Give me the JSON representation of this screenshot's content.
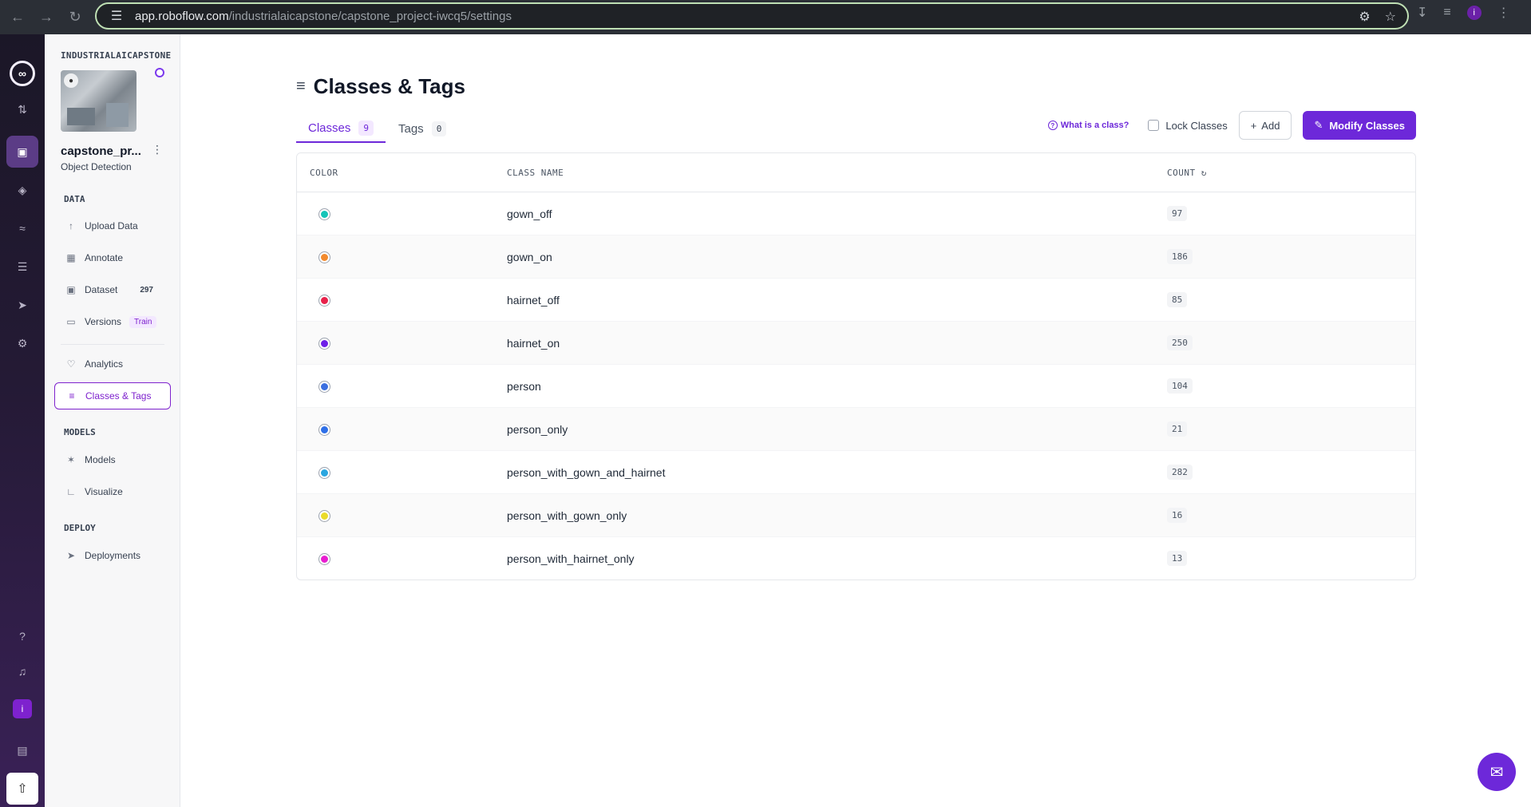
{
  "browser": {
    "url_host": "app.roboflow.com",
    "url_path": "/industrialaicapstone/capstone_project-iwcq5/settings"
  },
  "sidebar": {
    "workspace": "INDUSTRIALAICAPSTONE",
    "project_name": "capstone_pr...",
    "project_type": "Object Detection",
    "sections": {
      "data": "DATA",
      "models": "MODELS",
      "deploy": "DEPLOY"
    },
    "items": {
      "upload": "Upload Data",
      "annotate": "Annotate",
      "dataset": "Dataset",
      "dataset_count": "297",
      "versions": "Versions",
      "versions_badge": "Train",
      "analytics": "Analytics",
      "classes_tags": "Classes & Tags",
      "models": "Models",
      "visualize": "Visualize",
      "deployments": "Deployments"
    }
  },
  "rail": {
    "user_initial": "i"
  },
  "main": {
    "title": "Classes & Tags",
    "tabs": {
      "classes_label": "Classes",
      "classes_count": "9",
      "tags_label": "Tags",
      "tags_count": "0"
    },
    "actions": {
      "help": "What is a class?",
      "lock": "Lock Classes",
      "add": "Add",
      "modify": "Modify Classes"
    },
    "table": {
      "headers": [
        "COLOR",
        "CLASS NAME",
        "COUNT"
      ],
      "rows": [
        {
          "color": "#14c4b8",
          "name": "gown_off",
          "count": "97"
        },
        {
          "color": "#f28a2e",
          "name": "gown_on",
          "count": "186"
        },
        {
          "color": "#e8214a",
          "name": "hairnet_off",
          "count": "85"
        },
        {
          "color": "#6d1fe8",
          "name": "hairnet_on",
          "count": "250"
        },
        {
          "color": "#3b6fe0",
          "name": "person",
          "count": "104"
        },
        {
          "color": "#2e6fe8",
          "name": "person_only",
          "count": "21"
        },
        {
          "color": "#2aa6e0",
          "name": "person_with_gown_and_hairnet",
          "count": "282"
        },
        {
          "color": "#eadb2a",
          "name": "person_with_gown_only",
          "count": "16"
        },
        {
          "color": "#e81ed0",
          "name": "person_with_hairnet_only",
          "count": "13"
        }
      ]
    }
  }
}
